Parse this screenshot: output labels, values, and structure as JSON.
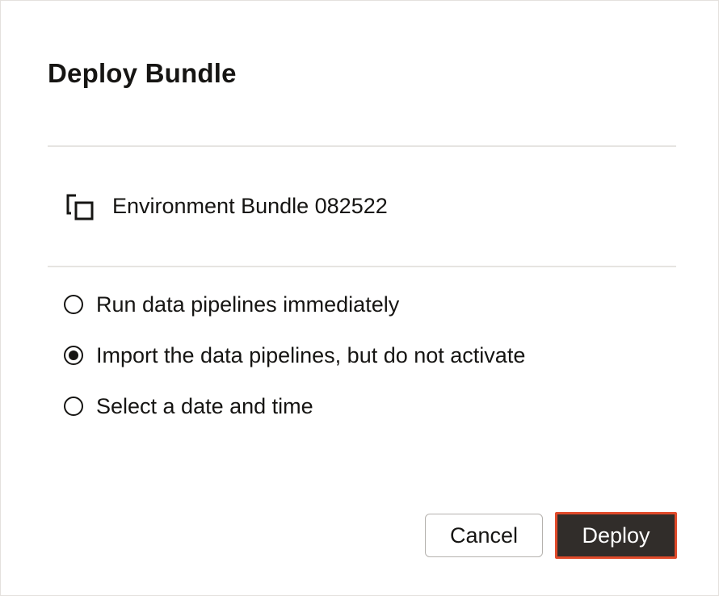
{
  "dialog": {
    "title": "Deploy Bundle"
  },
  "bundle": {
    "icon": "copy-icon",
    "name": "Environment Bundle 082522"
  },
  "options": [
    {
      "label": "Run data pipelines immediately",
      "selected": false
    },
    {
      "label": "Import the data pipelines, but do not activate",
      "selected": true
    },
    {
      "label": "Select a date and time",
      "selected": false
    }
  ],
  "buttons": {
    "cancel_label": "Cancel",
    "deploy_label": "Deploy"
  },
  "colors": {
    "text": "#161513",
    "primary_button_bg": "#312d2a",
    "highlight_border": "#e04a2a",
    "divider": "#e6e4e1"
  }
}
